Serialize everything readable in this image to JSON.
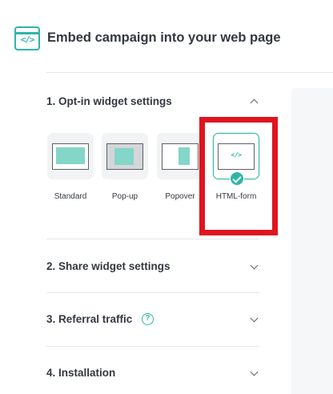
{
  "header": {
    "icon": "code-embed-icon",
    "icon_glyph": "</>",
    "title": "Embed campaign into your web page"
  },
  "sections": [
    {
      "title": "1. Opt-in widget settings",
      "expanded": true,
      "options": [
        {
          "label": "Standard",
          "icon": "standard-layout-icon",
          "selected": false
        },
        {
          "label": "Pop-up",
          "icon": "popup-layout-icon",
          "selected": false
        },
        {
          "label": "Popover",
          "icon": "popover-layout-icon",
          "selected": false
        },
        {
          "label": "HTML-form",
          "icon": "html-form-layout-icon",
          "glyph": "</>",
          "selected": true
        }
      ]
    },
    {
      "title": "2. Share widget settings",
      "expanded": false
    },
    {
      "title": "3. Referral traffic",
      "help_glyph": "?",
      "expanded": false
    },
    {
      "title": "4. Installation",
      "expanded": false
    }
  ],
  "colors": {
    "accent": "#2fb5a8",
    "thumb_fill": "#84d6c8",
    "highlight": "#e0141e"
  }
}
